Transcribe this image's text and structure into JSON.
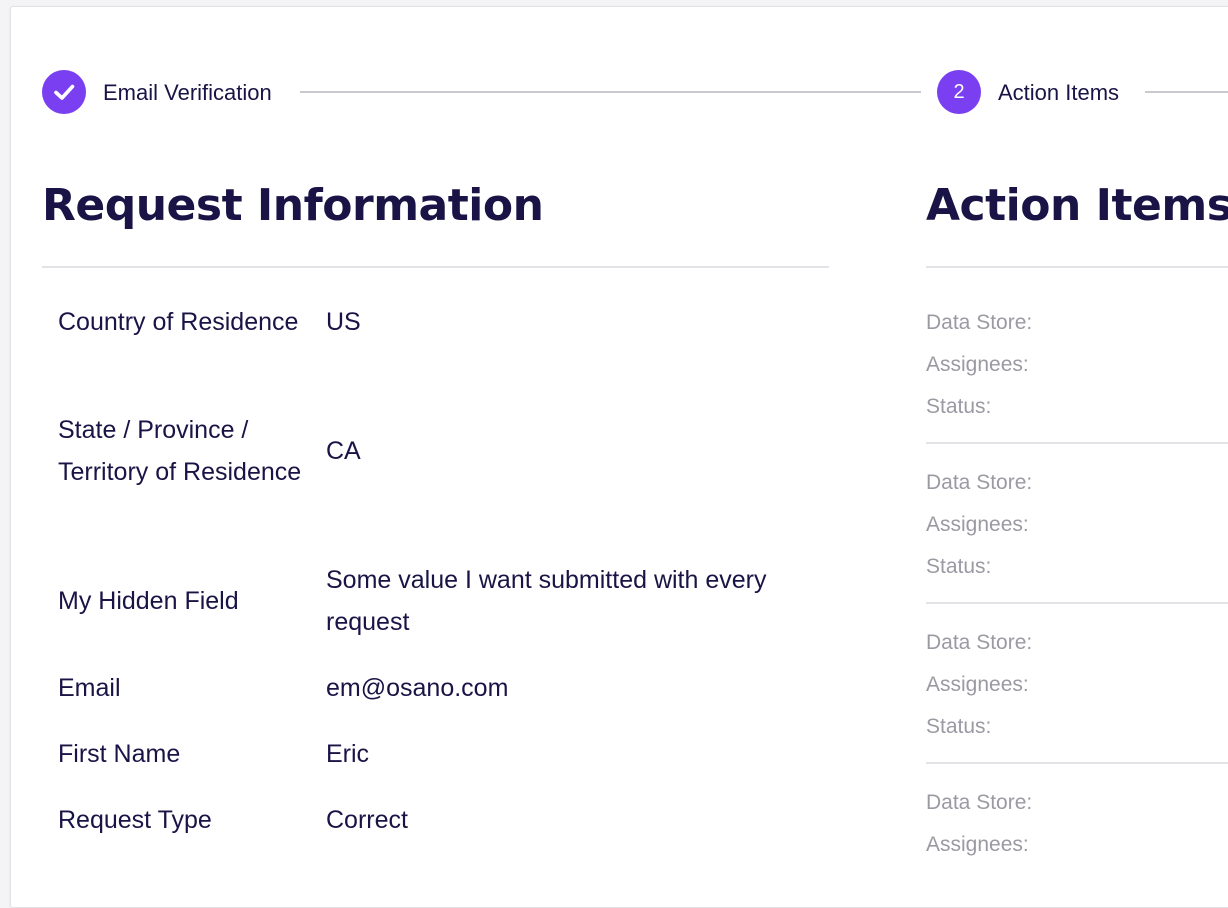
{
  "stepper": {
    "steps": [
      {
        "label": "Email Verification",
        "status": "complete",
        "icon": "check-icon"
      },
      {
        "label": "Action Items",
        "number": "2",
        "status": "current"
      }
    ],
    "accent_color": "#7a3ff0"
  },
  "request_info": {
    "title": "Request Information",
    "rows": [
      {
        "label": "Country of Residence",
        "value": "US"
      },
      {
        "label": "State / Province / Territory of Residence",
        "value": "CA"
      },
      {
        "label": "My Hidden Field",
        "value": "Some value I want submitted with every request"
      },
      {
        "label": "Email",
        "value": "em@osano.com"
      },
      {
        "label": "First Name",
        "value": "Eric"
      },
      {
        "label": "Request Type",
        "value": "Correct"
      }
    ]
  },
  "action_items": {
    "title": "Action Items",
    "items": [
      {
        "data_store_label": "Data Store:",
        "assignees_label": "Assignees:",
        "status_label": "Status:"
      },
      {
        "data_store_label": "Data Store:",
        "assignees_label": "Assignees:",
        "status_label": "Status:"
      },
      {
        "data_store_label": "Data Store:",
        "assignees_label": "Assignees:",
        "status_label": "Status:"
      },
      {
        "data_store_label": "Data Store:",
        "assignees_label": "Assignees:"
      }
    ]
  },
  "colors": {
    "text_primary": "#1a1446",
    "text_muted": "#9a9aa3",
    "divider": "#e3e3e7"
  }
}
